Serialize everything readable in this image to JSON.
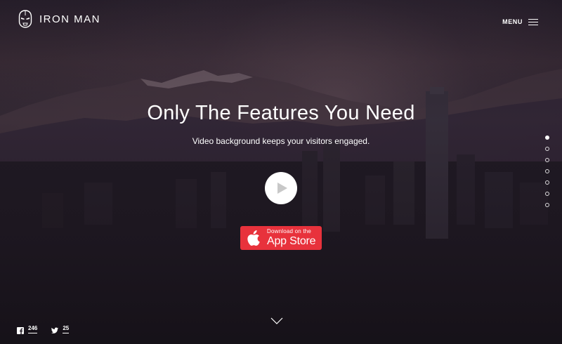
{
  "brand": {
    "name": "IRON MAN",
    "icon": "iron-man-helmet-icon"
  },
  "header": {
    "menu_label": "MENU",
    "menu_icon": "hamburger-icon"
  },
  "hero": {
    "headline": "Only The Features You Need",
    "subline": "Video background keeps your visitors engaged.",
    "play_icon": "play-icon"
  },
  "app_store": {
    "small_text": "Download on the",
    "big_text": "App Store",
    "icon": "apple-icon",
    "color": "#e8323c"
  },
  "pager": {
    "count": 7,
    "active_index": 0
  },
  "scroll_icon": "chevron-down-icon",
  "social": {
    "facebook_count": "246",
    "twitter_count": "25"
  }
}
